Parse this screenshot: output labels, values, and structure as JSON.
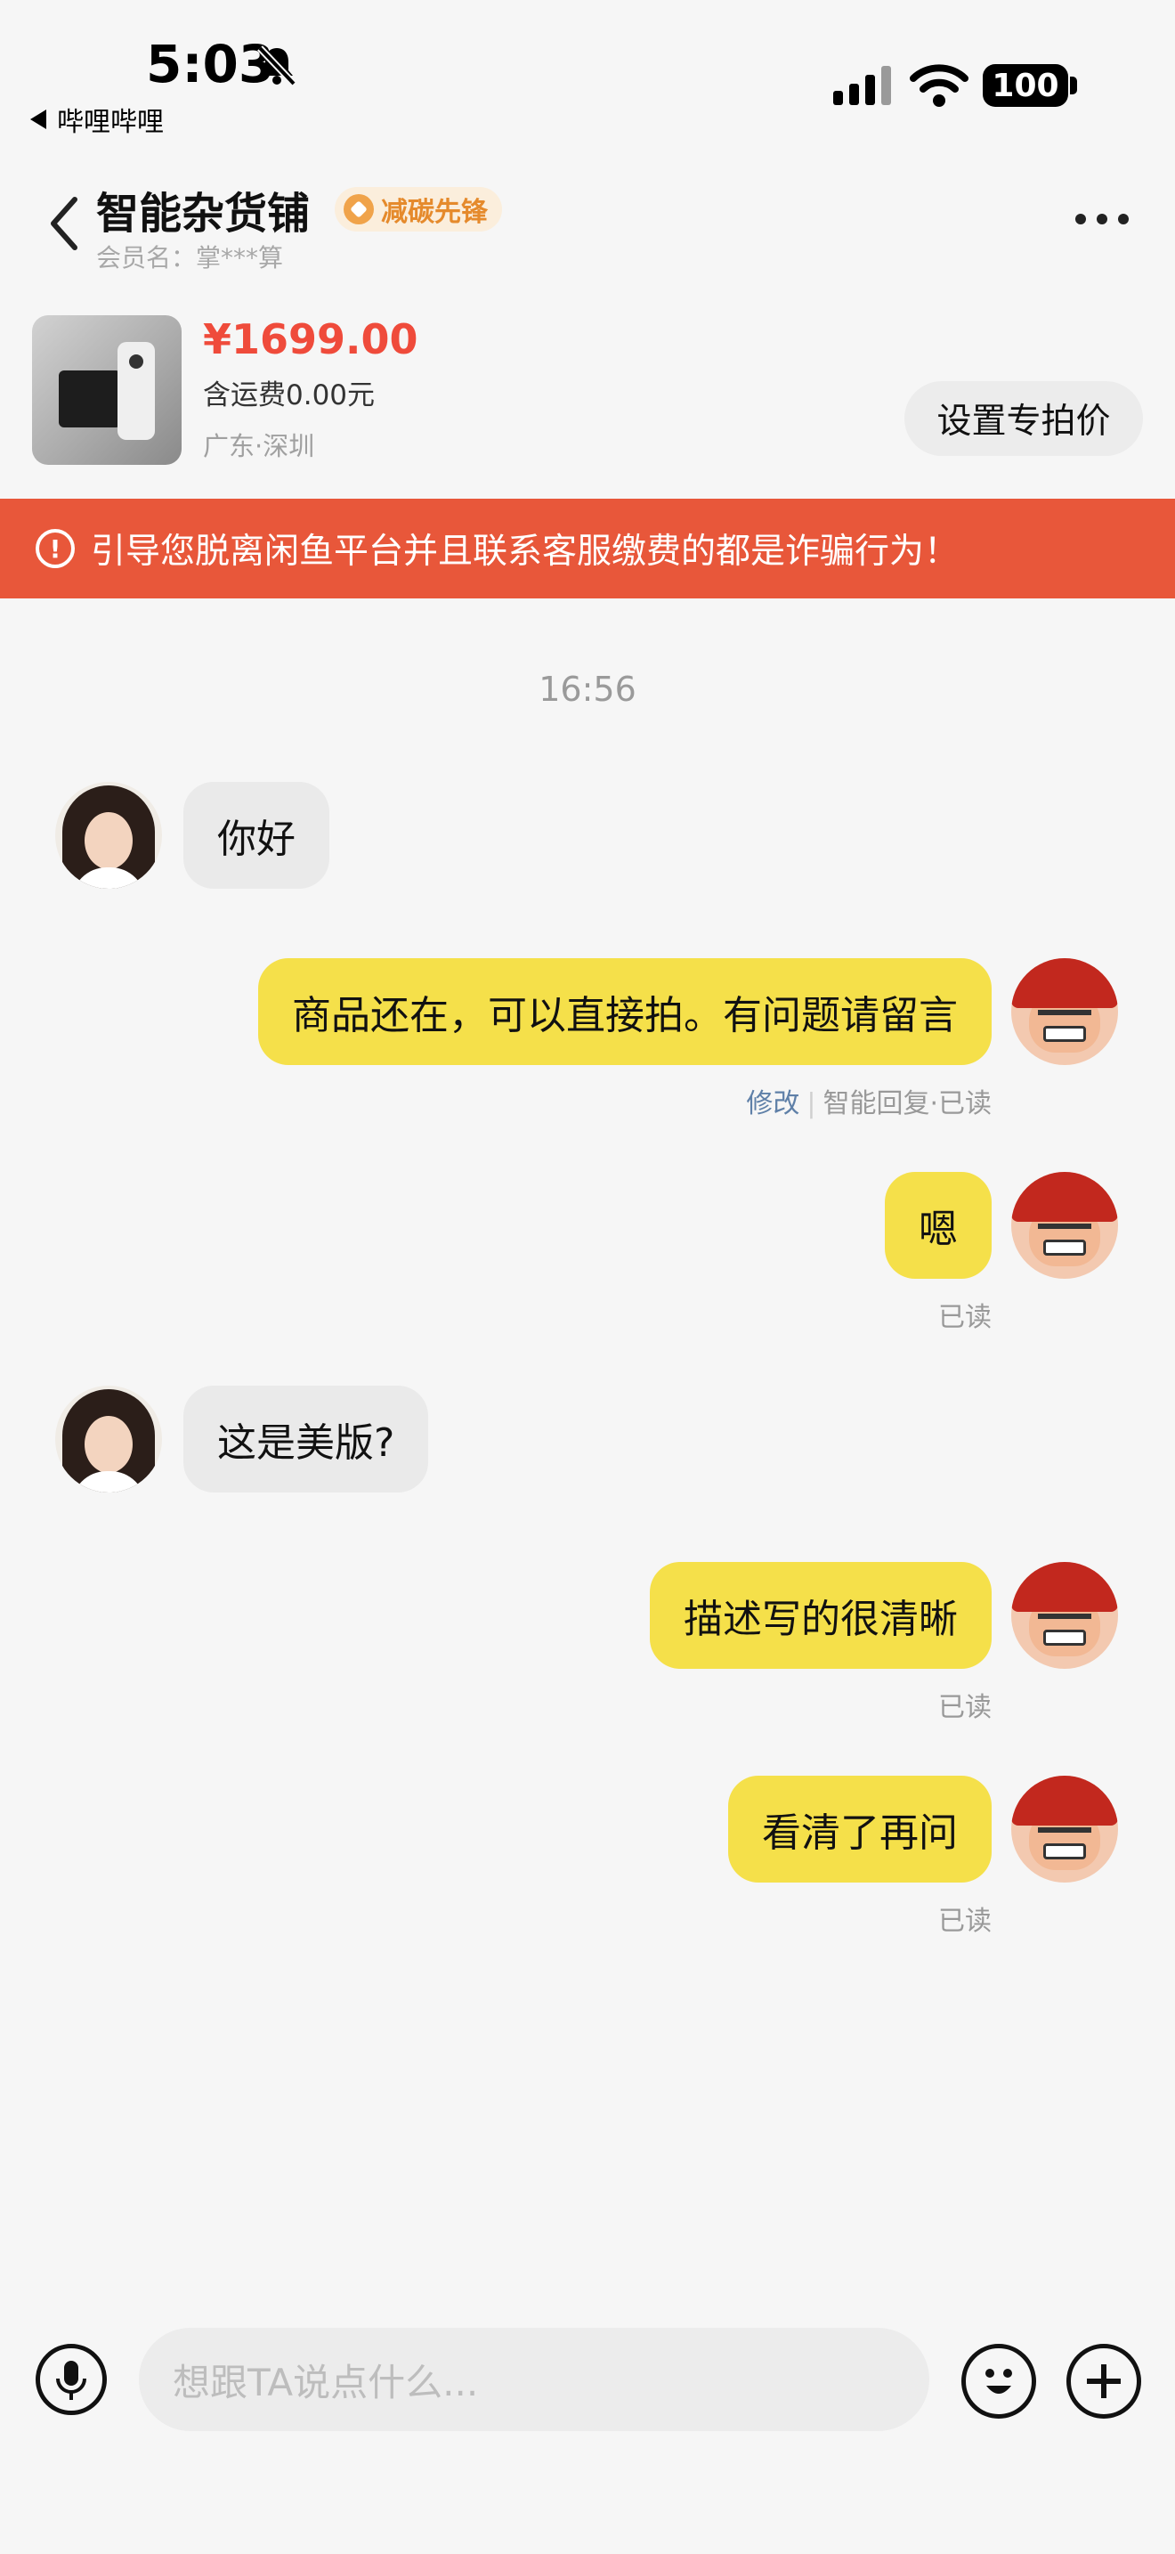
{
  "status_bar": {
    "time": "5:03",
    "back_app": "哔哩哔哩",
    "battery": "100",
    "icons": [
      "bell-muted-icon",
      "cellular-signal-icon",
      "wifi-icon",
      "battery-icon"
    ]
  },
  "header": {
    "shop_name": "智能杂货铺",
    "badge": "减碳先锋",
    "member": "会员名：掌***算",
    "icons": [
      "chevron-left-icon",
      "more-icon"
    ]
  },
  "product": {
    "price": "¥1699.00",
    "shipping": "含运费0.00元",
    "location": "广东·深圳",
    "special_price_button": "设置专拍价"
  },
  "warning": {
    "text": "引导您脱离闲鱼平台并且联系客服缴费的都是诈骗行为！"
  },
  "chat": {
    "timestamp": "16:56",
    "messages": [
      {
        "side": "in",
        "text": "你好"
      },
      {
        "side": "out",
        "text": "商品还在，可以直接拍。有问题请留言",
        "edit": "修改",
        "status": "智能回复·已读"
      },
      {
        "side": "out",
        "text": "嗯",
        "status": "已读"
      },
      {
        "side": "in",
        "text": "这是美版?"
      },
      {
        "side": "out",
        "text": "描述写的很清晰",
        "status": "已读"
      },
      {
        "side": "out",
        "text": "看清了再问",
        "status": "已读"
      }
    ]
  },
  "input_bar": {
    "placeholder": "想跟TA说点什么...",
    "icons": [
      "microphone-icon",
      "emoji-icon",
      "plus-icon"
    ]
  },
  "colors": {
    "accent_yellow": "#f5e04a",
    "price_red": "#ef4b3b",
    "warning_bg": "#e8573a",
    "badge_orange": "#e58a2c"
  }
}
